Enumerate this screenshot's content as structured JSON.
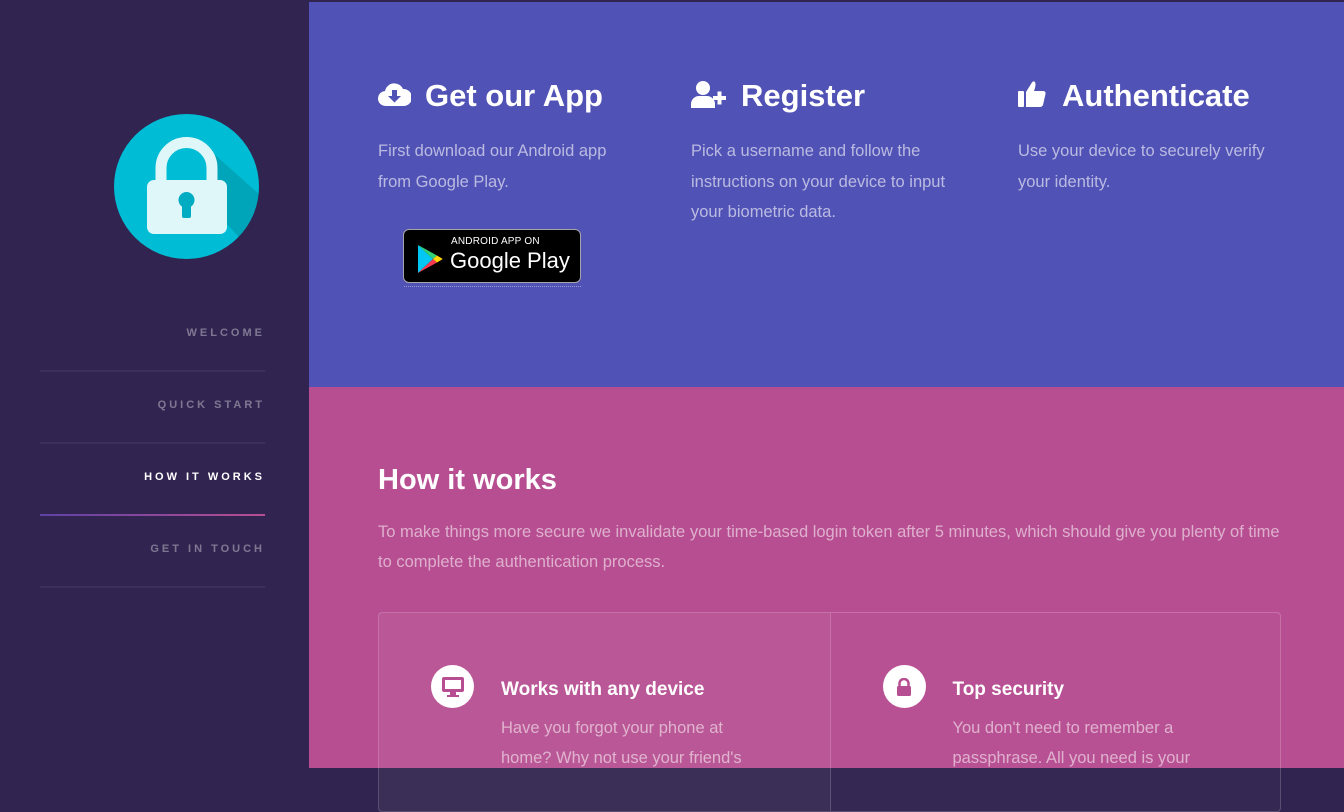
{
  "sidebar": {
    "nav": [
      {
        "label": "Welcome",
        "active": false
      },
      {
        "label": "Quick start",
        "active": false
      },
      {
        "label": "How it works",
        "active": true
      },
      {
        "label": "Get in touch",
        "active": false
      }
    ],
    "logo_icon": "lock-icon",
    "logo_color": "#00bcd4"
  },
  "steps": [
    {
      "icon": "cloud-download-icon",
      "title": "Get our App",
      "text": "First download our Android app from Google Play."
    },
    {
      "icon": "user-plus-icon",
      "title": "Register",
      "text": "Pick a username and follow the instructions on your device to input your biometric data."
    },
    {
      "icon": "thumbs-up-icon",
      "title": "Authenticate",
      "text": "Use your device to securely verify your identity."
    }
  ],
  "google_play": {
    "small": "ANDROID APP ON",
    "big": "Google Play"
  },
  "how": {
    "title": "How it works",
    "text": "To make things more secure we invalidate your time-based login token after 5 minutes, which should give you plenty of time to complete the authentication process.",
    "features": [
      {
        "icon": "desktop-icon",
        "title": "Works with any device",
        "text": "Have you forgot your phone at home? Why not use your friend's"
      },
      {
        "icon": "lock-icon",
        "title": "Top security",
        "text": "You don't need to remember a passphrase. All you need is your"
      }
    ]
  },
  "colors": {
    "sidebar": "#312450",
    "steps_bg": "#5052b5",
    "how_bg": "#b74e91",
    "accent": "#00bcd4"
  }
}
